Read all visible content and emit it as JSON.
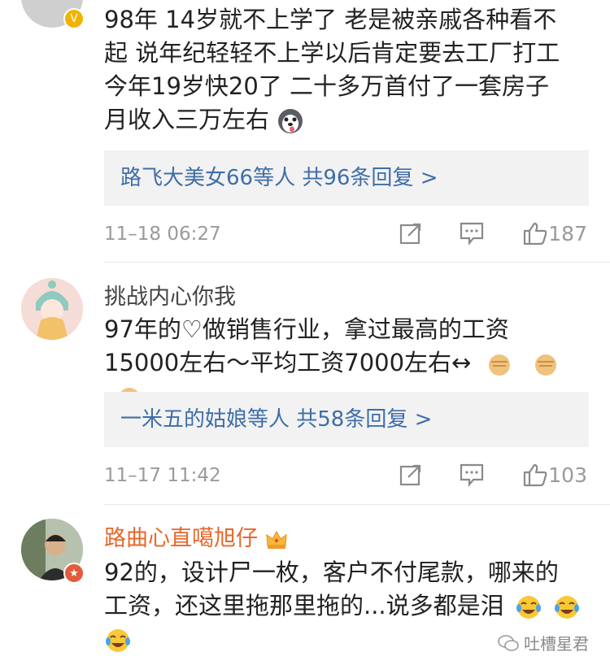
{
  "comments": [
    {
      "username": "",
      "text_line1": "98年 14岁就不上学了 老是被亲戚各种看不",
      "text_line2": "起 说年纪轻轻不上学以后肯定要去工厂打工",
      "text_line3": "今年19岁快20了  二十多万首付了一套房子",
      "text_line4": "月收入三万左右",
      "reply_summary": "路飞大美女66等人 共96条回复 >",
      "time": "11–18 06:27",
      "likes": "187"
    },
    {
      "username": "挑战内心你我",
      "text_line1": "97年的♡做销售行业，拿过最高的工资",
      "text_line2": "15000左右～平均工资7000左右↔",
      "reply_summary": "一米五的姑娘等人 共58条回复 >",
      "time": "11–17 11:42",
      "likes": "103"
    },
    {
      "username": "路曲心直噶旭仔",
      "text_line1": "92的，设计尸一枚，客户不付尾款，哪来的",
      "text_line2": "工资，还这里拖那里拖的...说多都是泪"
    }
  ],
  "watermark": "吐槽星君",
  "colors": {
    "link_blue": "#3f6ea8",
    "username_orange": "#e8672a",
    "meta_gray": "#9a9a9a",
    "reply_bg": "#f2f2f2"
  }
}
